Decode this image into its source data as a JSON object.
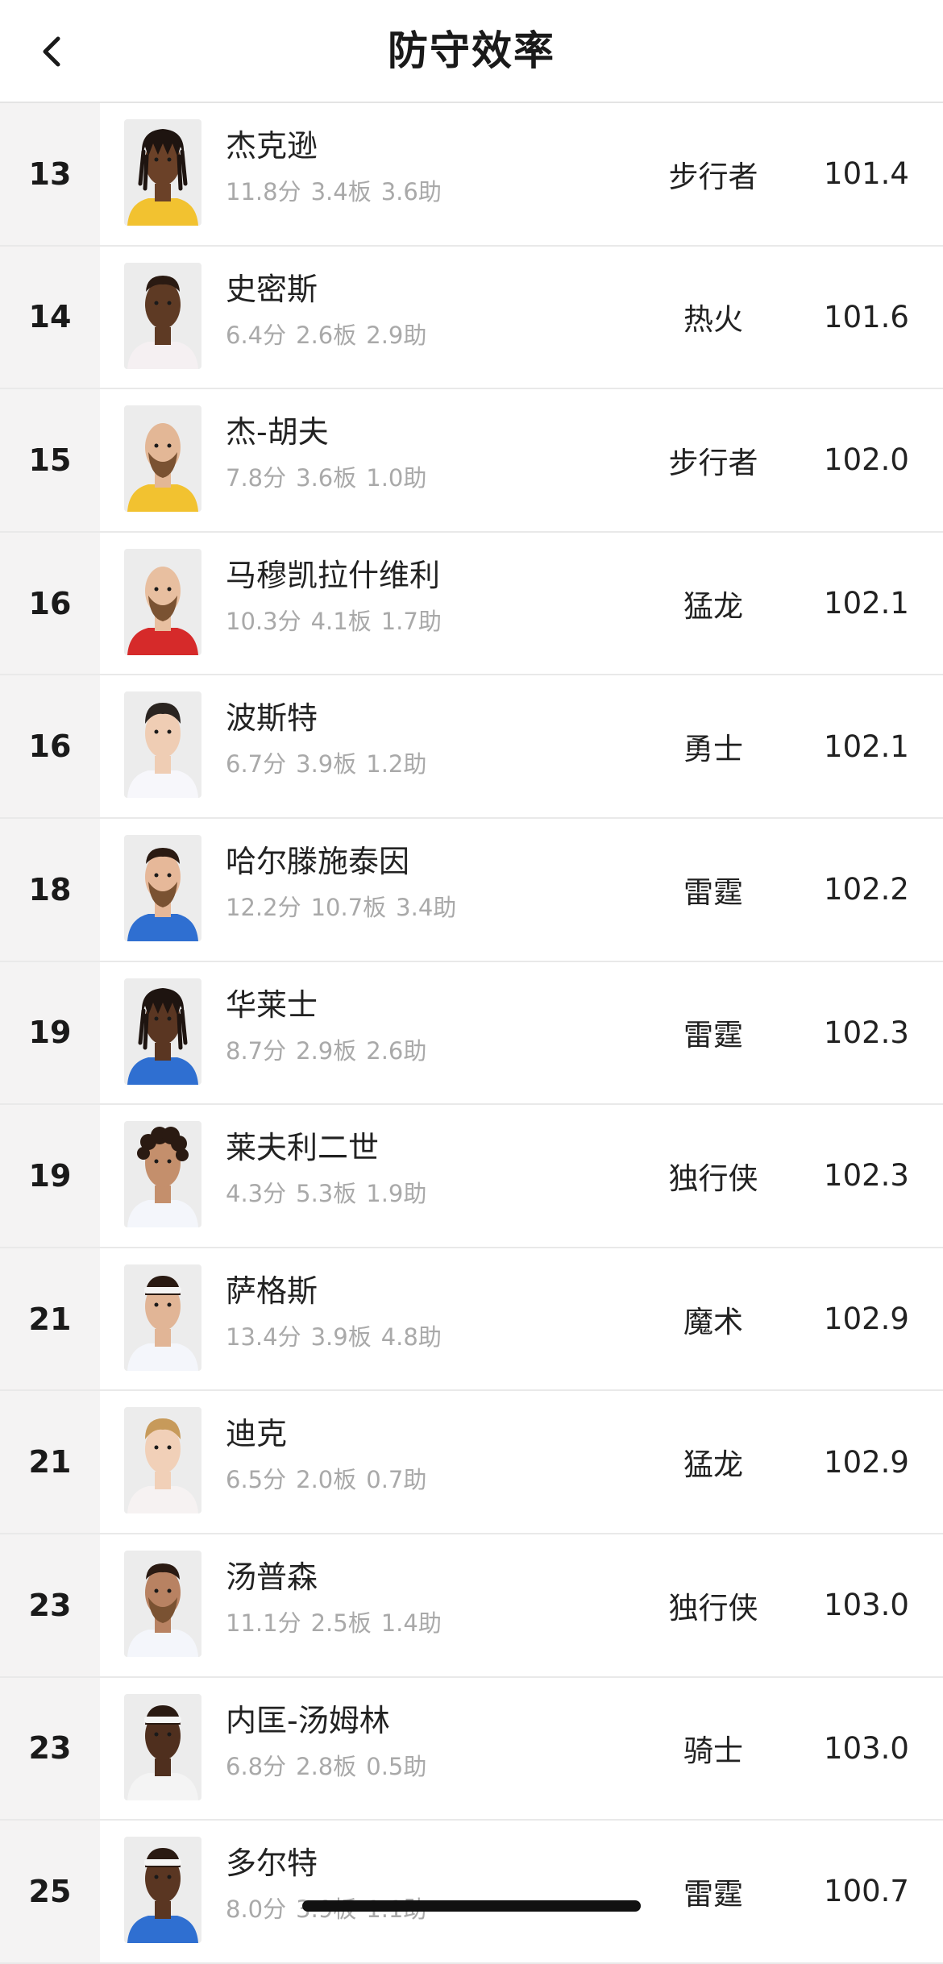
{
  "header": {
    "title": "防守效率",
    "back_icon": "chevron-left-icon"
  },
  "players": [
    {
      "rank": "13",
      "name": "杰克逊",
      "pts": "11.8分",
      "reb": "3.4板",
      "ast": "3.6助",
      "team": "步行者",
      "value": "101.4",
      "jersey_color": "#f2c230",
      "hair": "dreads",
      "skin": "#6b4128"
    },
    {
      "rank": "14",
      "name": "史密斯",
      "pts": "6.4分",
      "reb": "2.6板",
      "ast": "2.9助",
      "team": "热火",
      "value": "101.6",
      "jersey_color": "#f5f0f2",
      "hair": "short",
      "skin": "#5e3a24"
    },
    {
      "rank": "15",
      "name": "杰-胡夫",
      "pts": "7.8分",
      "reb": "3.6板",
      "ast": "1.0助",
      "team": "步行者",
      "value": "102.0",
      "jersey_color": "#f2c230",
      "hair": "bald-beard",
      "skin": "#e3b796"
    },
    {
      "rank": "16",
      "name": "马穆凯拉什维利",
      "pts": "10.3分",
      "reb": "4.1板",
      "ast": "1.7助",
      "team": "猛龙",
      "value": "102.1",
      "jersey_color": "#d62a2a",
      "hair": "bald-beard",
      "skin": "#e8bfa0"
    },
    {
      "rank": "16",
      "name": "波斯特",
      "pts": "6.7分",
      "reb": "3.9板",
      "ast": "1.2助",
      "team": "勇士",
      "value": "102.1",
      "jersey_color": "#f7f7fb",
      "hair": "short-dark",
      "skin": "#efcdb4"
    },
    {
      "rank": "18",
      "name": "哈尔滕施泰因",
      "pts": "12.2分",
      "reb": "10.7板",
      "ast": "3.4助",
      "team": "雷霆",
      "value": "102.2",
      "jersey_color": "#2f6fd1",
      "hair": "short-beard",
      "skin": "#e6b899"
    },
    {
      "rank": "19",
      "name": "华莱士",
      "pts": "8.7分",
      "reb": "2.9板",
      "ast": "2.6助",
      "team": "雷霆",
      "value": "102.3",
      "jersey_color": "#2f6fd1",
      "hair": "dreads",
      "skin": "#5a3622"
    },
    {
      "rank": "19",
      "name": "莱夫利二世",
      "pts": "4.3分",
      "reb": "5.3板",
      "ast": "1.9助",
      "team": "独行侠",
      "value": "102.3",
      "jersey_color": "#f4f6fb",
      "hair": "curly",
      "skin": "#c48f6c"
    },
    {
      "rank": "21",
      "name": "萨格斯",
      "pts": "13.4分",
      "reb": "3.9板",
      "ast": "4.8助",
      "team": "魔术",
      "value": "102.9",
      "jersey_color": "#f4f6fb",
      "hair": "headband",
      "skin": "#e1b596"
    },
    {
      "rank": "21",
      "name": "迪克",
      "pts": "6.5分",
      "reb": "2.0板",
      "ast": "0.7助",
      "team": "猛龙",
      "value": "102.9",
      "jersey_color": "#f6f2f2",
      "hair": "short-blond",
      "skin": "#f1d0b8"
    },
    {
      "rank": "23",
      "name": "汤普森",
      "pts": "11.1分",
      "reb": "2.5板",
      "ast": "1.4助",
      "team": "独行侠",
      "value": "103.0",
      "jersey_color": "#f4f6fb",
      "hair": "short-beard",
      "skin": "#b88262"
    },
    {
      "rank": "23",
      "name": "内匡-汤姆林",
      "pts": "6.8分",
      "reb": "2.8板",
      "ast": "0.5助",
      "team": "骑士",
      "value": "103.0",
      "jersey_color": "#f4f4f4",
      "hair": "headband",
      "skin": "#4f2f1e"
    },
    {
      "rank": "25",
      "name": "多尔特",
      "pts": "8.0分",
      "reb": "3.9板",
      "ast": "1.1助",
      "team": "雷霆",
      "value": "100.7",
      "jersey_color": "#2f6fd1",
      "hair": "headband",
      "skin": "#5a3622"
    }
  ]
}
